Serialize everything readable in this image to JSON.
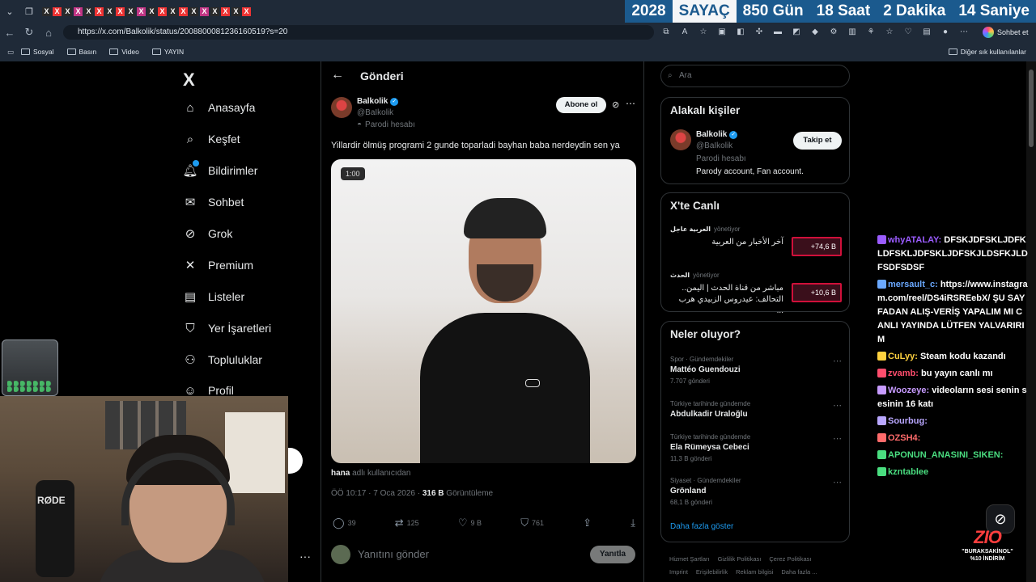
{
  "browser": {
    "tab_icons": [
      "X",
      "X",
      "X",
      "X",
      "X",
      "X",
      "X",
      "X",
      "X",
      "X",
      "X",
      "X",
      "X",
      "X",
      "X",
      "X",
      "X",
      "X",
      "X",
      "X"
    ],
    "url": "https://x.com/Balkolik/status/2008800081236160519?s=20",
    "bookmarks": [
      "Sosyal",
      "Basın",
      "Video",
      "YAYIN"
    ],
    "bookmarks_right": "Diğer sık kullanılanlar",
    "chat_button": "Sohbet et"
  },
  "counter": {
    "year": "2028",
    "label": "SAYAÇ",
    "days": "850 Gün",
    "hours": "18 Saat",
    "minutes": "2 Dakika",
    "seconds": "14 Saniye"
  },
  "sidebar": {
    "logo": "X",
    "items": [
      {
        "label": "Anasayfa",
        "icon": "home-icon"
      },
      {
        "label": "Keşfet",
        "icon": "search-icon"
      },
      {
        "label": "Bildirimler",
        "icon": "bell-icon"
      },
      {
        "label": "Sohbet",
        "icon": "mail-icon"
      },
      {
        "label": "Grok",
        "icon": "grok-icon"
      },
      {
        "label": "Premium",
        "icon": "x-icon"
      },
      {
        "label": "Listeler",
        "icon": "list-icon"
      },
      {
        "label": "Yer İşaretleri",
        "icon": "bookmark-icon"
      },
      {
        "label": "Topluluklar",
        "icon": "people-icon"
      },
      {
        "label": "Profil",
        "icon": "person-icon"
      }
    ],
    "more": "···"
  },
  "post": {
    "header_title": "Gönderi",
    "author_name": "Balkolik",
    "author_handle": "@BaIkolik",
    "author_tag": "Parodi hesabı",
    "follow_label": "Abone ol",
    "text": "Yillardir ölmüş programi 2 gunde toparladi bayhan baba nerdeydin sen ya",
    "media_duration": "1:00",
    "mention_user": "hana",
    "mention_suffix": "adlı kullanıcıdan",
    "timestamp": "ÖÖ 10:17 · 7 Oca 2026 · ",
    "views": "316 B",
    "views_label": " Görüntüleme",
    "replies": "39",
    "reposts": "125",
    "likes": "9 B",
    "bookmarks": "761",
    "reply_placeholder": "Yanıtını gönder",
    "reply_button": "Yanıtla"
  },
  "right": {
    "search_placeholder": "Ara",
    "related_title": "Alakalı kişiler",
    "related": {
      "name": "Balkolik",
      "handle": "@BaIkolik",
      "tag": "Parodi hesabı",
      "bio": "Parody account, Fan account.",
      "follow_label": "Takip et"
    },
    "live_title": "X'te Canlı",
    "live": [
      {
        "channel": "العربية عاجل",
        "role": "yönetiyor",
        "title": "آخر الأخبار من العربية",
        "count": "+74,6 B"
      },
      {
        "channel": "الحدث",
        "role": "yönetiyor",
        "title": "مباشر من قناة الحدث | اليمن.. التحالف: عيدروس الزبيدي هرب ...",
        "count": "+10,6 B"
      }
    ],
    "trends_title": "Neler oluyor?",
    "trends": [
      {
        "category": "Spor · Gündemdekiler",
        "name": "Mattéo Guendouzi",
        "count": "7.707 gönderi"
      },
      {
        "category": "Türkiye tarihinde gündemde",
        "name": "Abdulkadir Uraloğlu",
        "count": ""
      },
      {
        "category": "Türkiye tarihinde gündemde",
        "name": "Ela Rümeysa Cebeci",
        "count": "11,3 B gönderi"
      },
      {
        "category": "Siyaset · Gündemdekiler",
        "name": "Grönland",
        "count": "68,1 B gönderi"
      }
    ],
    "show_more": "Daha fazla göster",
    "footer": [
      "Hizmet Şartları",
      "Gizlilik Politikası",
      "Çerez Politikası",
      "Imprint",
      "Erişilebilirlik",
      "Reklam bilgisi",
      "Daha fazla ..."
    ]
  },
  "chat": [
    {
      "user": "whyATALAY:",
      "color": "#9b5cff",
      "text": "DFSKJDFSKLJDFKLDFSKLJDFSKLJDFSKJLDSFKJLDFSDFSDSF"
    },
    {
      "user": "mersault_c:",
      "color": "#6aa8ff",
      "text": "https://www.instagram.com/reel/DS4iRSREebX/ ŞU SAYFADAN ALIŞ-VERİŞ YAPALIM MI CANLI YAYINDA LÜTFEN YALVARIRIM"
    },
    {
      "user": "CuLyy:",
      "color": "#ffd23f",
      "text": "Steam kodu kazandı"
    },
    {
      "user": "zvamb:",
      "color": "#ff4d6d",
      "text": "bu yayın canlı mı"
    },
    {
      "user": "Woozeye:",
      "color": "#c79bff",
      "text": "videoların sesi senin sesinin 16 katı"
    },
    {
      "user": "Sourbug:",
      "color": "#b9a7ff",
      "text": ""
    },
    {
      "user": "OZSH4:",
      "color": "#ff6b6b",
      "text": ""
    },
    {
      "user": "APONUN_ANASINI_SIKEN:",
      "color": "#4ade80",
      "text": ""
    },
    {
      "user": "kzntablee",
      "color": "#4ade80",
      "text": ""
    }
  ],
  "promo": {
    "logo": "ZIO",
    "line1": "\"BURAKSAKİNOL\"",
    "line2": "%10 İNDİRİM"
  }
}
